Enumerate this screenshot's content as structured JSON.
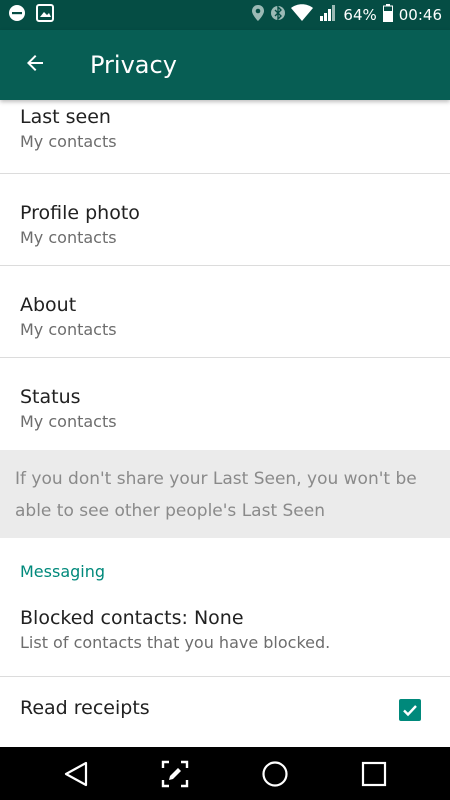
{
  "status_bar": {
    "battery": "64%",
    "time": "00:46",
    "icons": [
      "minus-circle-icon",
      "image-icon",
      "location-icon",
      "bluetooth-icon",
      "wifi-icon",
      "signal-icon",
      "battery-icon"
    ]
  },
  "app_bar": {
    "title": "Privacy",
    "back_icon": "arrow-back-icon"
  },
  "privacy_items": [
    {
      "label": "Last seen",
      "value": "My contacts"
    },
    {
      "label": "Profile photo",
      "value": "My contacts"
    },
    {
      "label": "About",
      "value": "My contacts"
    },
    {
      "label": "Status",
      "value": "My contacts"
    }
  ],
  "note": "If you don't share your Last Seen, you won't be able to see other people's Last Seen",
  "messaging": {
    "header": "Messaging",
    "blocked": {
      "label": "Blocked contacts: None",
      "desc": "List of contacts that you have blocked."
    },
    "read_receipts": {
      "label": "Read receipts",
      "checked": true
    }
  },
  "colors": {
    "header": "#075e54",
    "status_bar": "#054d44",
    "accent": "#00897b"
  },
  "nav_bar": {
    "icons": [
      "back-triangle-icon",
      "screenshot-edit-icon",
      "home-circle-icon",
      "recents-square-icon"
    ]
  }
}
